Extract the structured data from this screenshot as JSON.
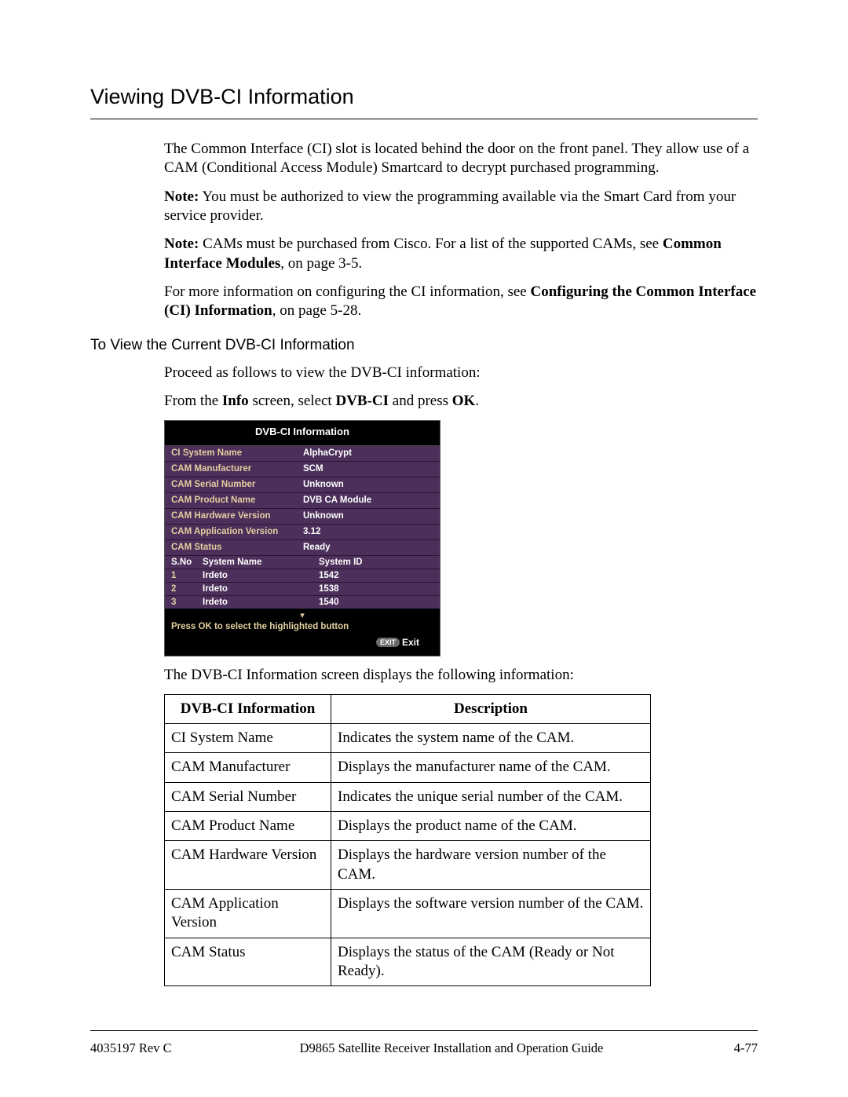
{
  "section_title": "Viewing DVB-CI Information",
  "paragraphs": {
    "p1": "The Common Interface (CI) slot is located behind the door on the front panel. They allow use of a CAM (Conditional Access Module) Smartcard to decrypt purchased programming.",
    "note1_label": "Note:",
    "note1_text": "  You must be authorized to view the programming available via the Smart Card from your service provider.",
    "note2_label": "Note:",
    "note2_text": "  CAMs must be purchased from Cisco. For a list of the supported CAMs, see ",
    "note2_link": "Common Interface Modules",
    "note2_suffix": ", on page 3-5.",
    "p4_prefix": "For more information on configuring the CI information, see ",
    "p4_link": "Configuring the Common Interface (CI) Information",
    "p4_suffix": ", on page 5-28."
  },
  "sub_heading": "To View the Current DVB-CI Information",
  "proc": {
    "p1": "Proceed as follows to view the DVB-CI information:",
    "p2_a": "From the ",
    "p2_b": "Info",
    "p2_c": " screen, select ",
    "p2_d": "DVB-CI",
    "p2_e": " and press ",
    "p2_f": "OK",
    "p2_g": "."
  },
  "ui": {
    "title": "DVB-CI Information",
    "fields": [
      {
        "label": "CI System Name",
        "value": "AlphaCrypt"
      },
      {
        "label": "CAM Manufacturer",
        "value": "SCM"
      },
      {
        "label": "CAM Serial Number",
        "value": "Unknown"
      },
      {
        "label": "CAM Product Name",
        "value": "DVB CA Module"
      },
      {
        "label": "CAM Hardware Version",
        "value": "Unknown"
      },
      {
        "label": "CAM Application Version",
        "value": "3.12"
      },
      {
        "label": "CAM Status",
        "value": "Ready"
      }
    ],
    "cols": {
      "sno": "S.No",
      "name": "System Name",
      "id": "System ID"
    },
    "rows": [
      {
        "sno": "1",
        "name": "Irdeto",
        "id": "1542"
      },
      {
        "sno": "2",
        "name": "Irdeto",
        "id": "1538"
      },
      {
        "sno": "3",
        "name": "Irdeto",
        "id": "1540"
      }
    ],
    "hint": "Press OK to select the highlighted button",
    "exit_pill": "EXIT",
    "exit_label": "Exit"
  },
  "caption": "The DVB-CI Information screen displays the following information:",
  "table": {
    "h1": "DVB-CI Information",
    "h2": "Description",
    "rows": [
      {
        "c1": "CI System Name",
        "c2": "Indicates the system name of the CAM."
      },
      {
        "c1": "CAM Manufacturer",
        "c2": "Displays the manufacturer name of the CAM."
      },
      {
        "c1": "CAM Serial Number",
        "c2": "Indicates the unique serial number of the CAM."
      },
      {
        "c1": "CAM Product Name",
        "c2": "Displays the product name of the CAM."
      },
      {
        "c1": "CAM Hardware Version",
        "c2": "Displays the hardware version number of the CAM."
      },
      {
        "c1": "CAM Application Version",
        "c2": "Displays the software version number of the CAM."
      },
      {
        "c1": "CAM Status",
        "c2": "Displays the status of the CAM (Ready or Not Ready)."
      }
    ]
  },
  "footer": {
    "left": "4035197 Rev C",
    "center": "D9865 Satellite Receiver Installation and Operation Guide",
    "right": "4-77"
  }
}
